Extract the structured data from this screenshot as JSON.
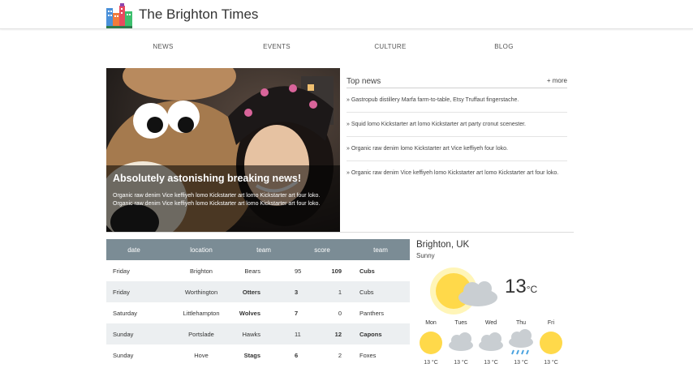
{
  "header": {
    "site_title": "The Brighton Times",
    "logo_icon": "city-buildings-icon"
  },
  "nav": [
    "NEWS",
    "EVENTS",
    "CULTURE",
    "BLOG"
  ],
  "hero": {
    "title": "Absolutely astonishing breaking news!",
    "text": "Organic raw denim Vice keffiyeh lomo Kickstarter art lomo Kickstarter art four loko. Organic raw denim Vice keffiyeh lomo Kickstarter art lomo Kickstarter art four loko."
  },
  "top_news": {
    "title": "Top news",
    "more": "+ more",
    "items": [
      "» Gastropub distillery Marfa farm-to-table, Etsy Truffaut fingerstache.",
      "» Squid lomo Kickstarter art lomo Kickstarter art party cronut scenester.",
      "» Organic raw denim lomo Kickstarter art Vice keffiyeh four loko.",
      "» Organic raw denim Vice keffiyeh lomo Kickstarter art lomo Kickstarter art four loko."
    ]
  },
  "scores": {
    "headers": [
      "date",
      "location",
      "team",
      "score",
      "team"
    ],
    "rows": [
      {
        "date": "Friday",
        "location": "Brighton",
        "team1": "Bears",
        "s1": "95",
        "s2": "109",
        "team2": "Cubs",
        "winner": 2
      },
      {
        "date": "Friday",
        "location": "Worthington",
        "team1": "Otters",
        "s1": "3",
        "s2": "1",
        "team2": "Cubs",
        "winner": 1
      },
      {
        "date": "Saturday",
        "location": "Littlehampton",
        "team1": "Wolves",
        "s1": "7",
        "s2": "0",
        "team2": "Panthers",
        "winner": 1
      },
      {
        "date": "Sunday",
        "location": "Portslade",
        "team1": "Hawks",
        "s1": "11",
        "s2": "12",
        "team2": "Capons",
        "winner": 2
      },
      {
        "date": "Sunday",
        "location": "Hove",
        "team1": "Stags",
        "s1": "6",
        "s2": "2",
        "team2": "Foxes",
        "winner": 1
      }
    ]
  },
  "weather": {
    "city": "Brighton, UK",
    "condition": "Sunny",
    "temp": "13",
    "unit": "°C",
    "current_icon": "sun-cloud-icon",
    "forecast": [
      {
        "day": "Mon",
        "temp": "13 °C",
        "icon": "sun-icon"
      },
      {
        "day": "Tues",
        "temp": "13 °C",
        "icon": "cloud-icon"
      },
      {
        "day": "Wed",
        "temp": "13 °C",
        "icon": "cloud-icon"
      },
      {
        "day": "Thu",
        "temp": "13 °C",
        "icon": "rain-icon"
      },
      {
        "day": "Fri",
        "temp": "13 °C",
        "icon": "sun-icon"
      }
    ]
  },
  "colors": {
    "table_header": "#7b8c95",
    "row_alt": "#eceff1",
    "sun": "#ffd94a"
  }
}
